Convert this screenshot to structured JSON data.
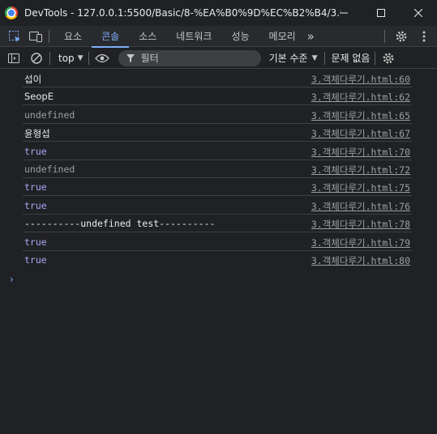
{
  "window": {
    "title": "DevTools - 127.0.0.1:5500/Basic/8-%EA%B0%9D%EC%B2%B4/3.%E..."
  },
  "tabs": [
    {
      "label": "요소"
    },
    {
      "label": "콘솔",
      "active": true
    },
    {
      "label": "소스"
    },
    {
      "label": "네트워크"
    },
    {
      "label": "성능"
    },
    {
      "label": "메모리"
    }
  ],
  "toolbar": {
    "context": "top",
    "filter_placeholder": "필터",
    "levels": "기본 수준",
    "issues": "문제 없음"
  },
  "console": [
    {
      "text": "섭이",
      "kind": "plain",
      "source": "3.객체다루기.html:60"
    },
    {
      "text": "SeopE",
      "kind": "plain",
      "source": "3.객체다루기.html:62"
    },
    {
      "text": "undefined",
      "kind": "undef",
      "source": "3.객체다루기.html:65"
    },
    {
      "text": "윤형섭",
      "kind": "plain",
      "source": "3.객체다루기.html:67"
    },
    {
      "text": "true",
      "kind": "bool",
      "source": "3.객체다루기.html:70"
    },
    {
      "text": "undefined",
      "kind": "undef",
      "source": "3.객체다루기.html:72"
    },
    {
      "text": "true",
      "kind": "bool",
      "source": "3.객체다루기.html:75"
    },
    {
      "text": "true",
      "kind": "bool",
      "source": "3.객체다루기.html:76"
    },
    {
      "text": "----------undefined test----------",
      "kind": "mono",
      "source": "3.객체다루기.html:78"
    },
    {
      "text": "true",
      "kind": "bool",
      "source": "3.객체다루기.html:79"
    },
    {
      "text": "true",
      "kind": "bool",
      "source": "3.객체다루기.html:80"
    }
  ],
  "icons": {
    "inspect": "inspect-element-icon",
    "device": "device-toolbar-icon",
    "more": "chevron-double-right-icon",
    "settings": "gear-icon",
    "menu": "kebab-menu-icon",
    "sidebar": "sidebar-toggle-icon",
    "clear": "clear-console-icon",
    "eye": "eye-icon",
    "filter": "filter-icon"
  }
}
